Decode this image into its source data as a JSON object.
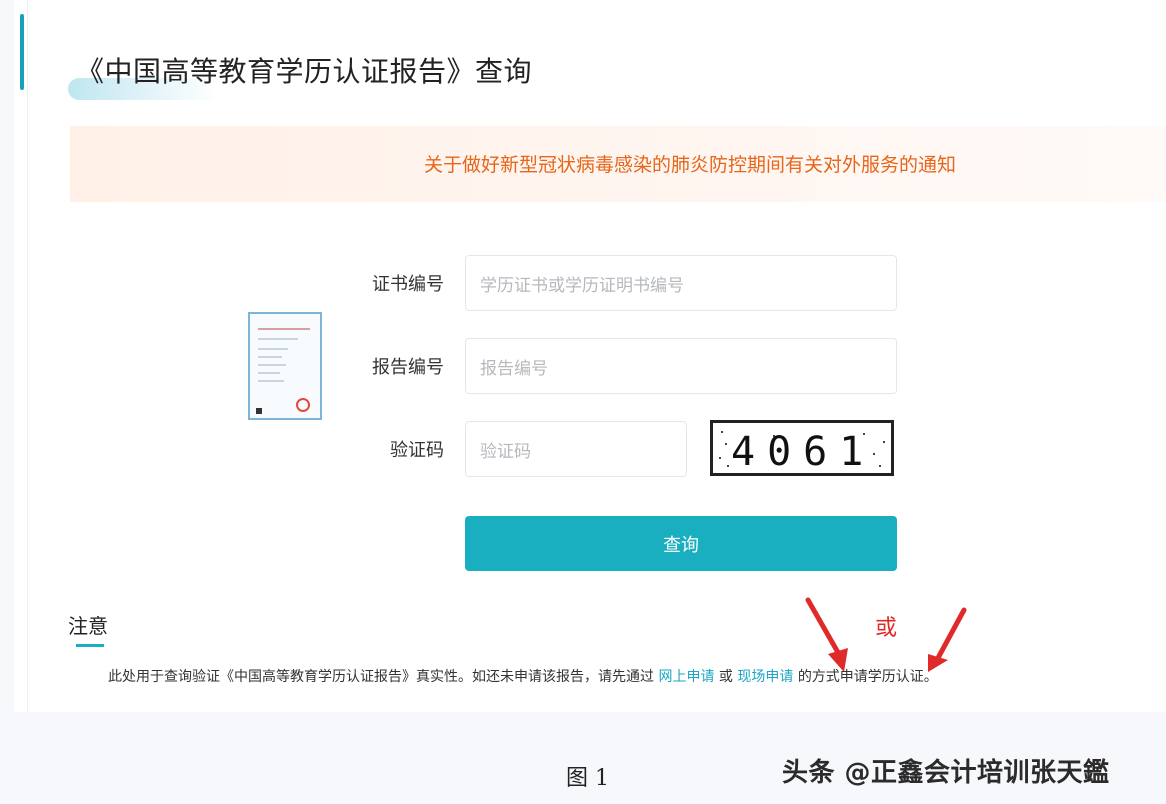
{
  "page": {
    "title": "《中国高等教育学历认证报告》查询"
  },
  "notice": {
    "text": "关于做好新型冠状病毒感染的肺炎防控期间有关对外服务的通知"
  },
  "form": {
    "certificate_label": "证书编号",
    "certificate_placeholder": "学历证书或学历证明书编号",
    "report_label": "报告编号",
    "report_placeholder": "报告编号",
    "captcha_label": "验证码",
    "captcha_placeholder": "验证码",
    "captcha_image_text": "4061",
    "submit_label": "查询"
  },
  "note": {
    "title": "注意",
    "text_before": "此处用于查询验证《中国高等教育学历认证报告》真实性。如还未申请该报告，请先通过",
    "online_link": "网上申请",
    "connector": "或",
    "onsite_link": "现场申请",
    "text_after": "的方式申请学历认证。"
  },
  "annotation": {
    "or_label": "或",
    "arrow_color": "#e02a2a"
  },
  "caption": {
    "figure": "图 1"
  },
  "watermark": {
    "text": "头条 @正鑫会计培训张天鑑"
  },
  "colors": {
    "accent": "#1aafc0",
    "notice_text": "#e8651a",
    "link": "#1aa6c4"
  }
}
